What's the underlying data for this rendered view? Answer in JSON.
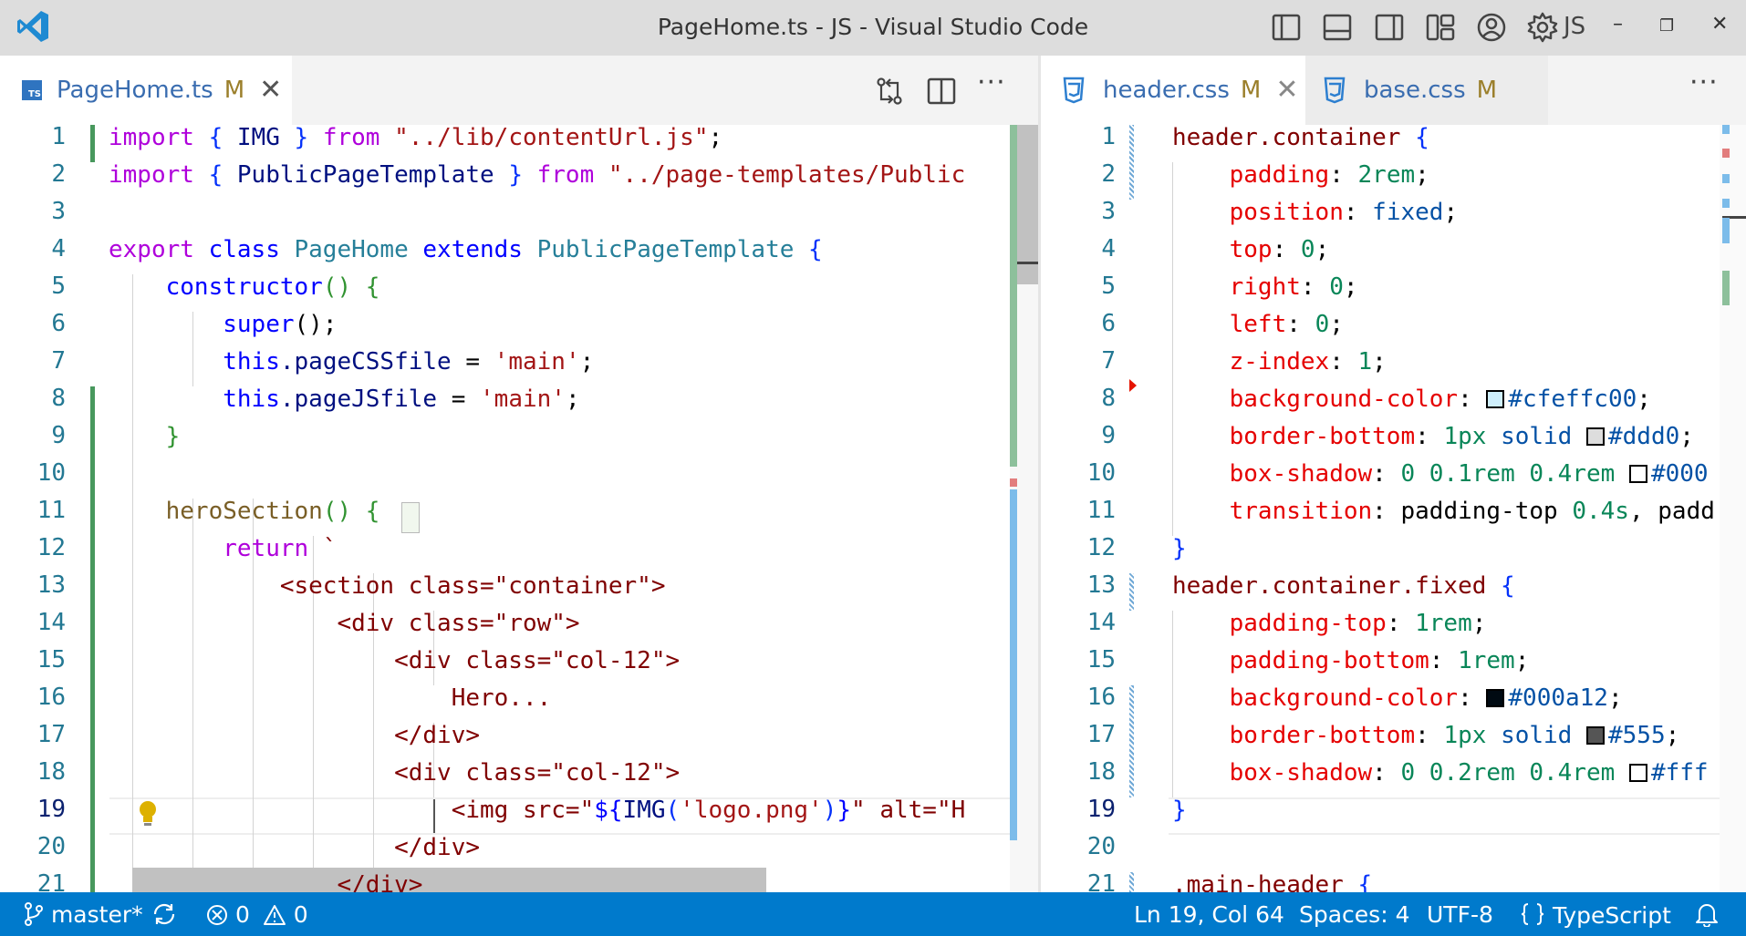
{
  "window": {
    "title": "PageHome.ts - JS - Visual Studio Code",
    "account_label": "JS",
    "controls": {
      "minimize": "–",
      "restore": "❐",
      "close": "✕"
    }
  },
  "colors": {
    "accent": "#007acc",
    "modified_gutter": "#48985d",
    "titlebar": "#dddddd"
  },
  "left_editor": {
    "tab": {
      "filename": "PageHome.ts",
      "status": "M",
      "close": "✕",
      "more": "···"
    },
    "lines": [
      {
        "n": "1",
        "tokens": [
          [
            "import ",
            "kw"
          ],
          [
            "{ ",
            "p1"
          ],
          [
            "IMG ",
            "id"
          ],
          [
            "} ",
            "p1"
          ],
          [
            "from ",
            "kw"
          ],
          [
            "\"../lib/contentUrl.js\"",
            "str"
          ],
          [
            ";",
            "txt"
          ]
        ]
      },
      {
        "n": "2",
        "tokens": [
          [
            "import ",
            "kw"
          ],
          [
            "{ ",
            "p1"
          ],
          [
            "PublicPageTemplate ",
            "id"
          ],
          [
            "} ",
            "p1"
          ],
          [
            "from ",
            "kw"
          ],
          [
            "\"../page-templates/Public",
            "str"
          ]
        ]
      },
      {
        "n": "3",
        "tokens": []
      },
      {
        "n": "4",
        "tokens": [
          [
            "export ",
            "kw"
          ],
          [
            "class ",
            "kwb"
          ],
          [
            "PageHome ",
            "cls"
          ],
          [
            "extends ",
            "kwb"
          ],
          [
            "PublicPageTemplate ",
            "cls"
          ],
          [
            "{",
            "p1"
          ]
        ]
      },
      {
        "n": "5",
        "tokens": [
          [
            "    ",
            "txt"
          ],
          [
            "constructor",
            "kwb"
          ],
          [
            "() {",
            "p2"
          ]
        ]
      },
      {
        "n": "6",
        "tokens": [
          [
            "        ",
            "txt"
          ],
          [
            "super",
            "kwb"
          ],
          [
            "();",
            "txt"
          ]
        ]
      },
      {
        "n": "7",
        "tokens": [
          [
            "        ",
            "txt"
          ],
          [
            "this",
            "kwb"
          ],
          [
            ".pageCSSfile ",
            "id"
          ],
          [
            "= ",
            "txt"
          ],
          [
            "'main'",
            "str"
          ],
          [
            ";",
            "txt"
          ]
        ]
      },
      {
        "n": "8",
        "tokens": [
          [
            "        ",
            "txt"
          ],
          [
            "this",
            "kwb"
          ],
          [
            ".pageJSfile ",
            "id"
          ],
          [
            "= ",
            "txt"
          ],
          [
            "'main'",
            "str"
          ],
          [
            ";",
            "txt"
          ]
        ]
      },
      {
        "n": "9",
        "tokens": [
          [
            "    ",
            "txt"
          ],
          [
            "}",
            "p2"
          ]
        ]
      },
      {
        "n": "10",
        "tokens": []
      },
      {
        "n": "11",
        "tokens": [
          [
            "    ",
            "txt"
          ],
          [
            "heroSection",
            "fn"
          ],
          [
            "() ",
            "p2"
          ],
          [
            "{",
            "p2"
          ]
        ]
      },
      {
        "n": "12",
        "tokens": [
          [
            "        ",
            "txt"
          ],
          [
            "return ",
            "kw"
          ],
          [
            "`",
            "tpl"
          ]
        ]
      },
      {
        "n": "13",
        "tokens": [
          [
            "            ",
            "txt"
          ],
          [
            "<section class=\"container\">",
            "tpl"
          ]
        ]
      },
      {
        "n": "14",
        "tokens": [
          [
            "                ",
            "txt"
          ],
          [
            "<div class=\"row\">",
            "tpl"
          ]
        ]
      },
      {
        "n": "15",
        "tokens": [
          [
            "                    ",
            "txt"
          ],
          [
            "<div class=\"col-12\">",
            "tpl"
          ]
        ]
      },
      {
        "n": "16",
        "tokens": [
          [
            "                        ",
            "txt"
          ],
          [
            "Hero...",
            "tpl"
          ]
        ]
      },
      {
        "n": "17",
        "tokens": [
          [
            "                    ",
            "txt"
          ],
          [
            "</div>",
            "tpl"
          ]
        ]
      },
      {
        "n": "18",
        "tokens": [
          [
            "                    ",
            "txt"
          ],
          [
            "<div class=\"col-12\">",
            "tpl"
          ]
        ]
      },
      {
        "n": "19",
        "tokens": [
          [
            "                        ",
            "txt"
          ],
          [
            "<img src=\"",
            "tpl"
          ],
          [
            "${",
            "kwb"
          ],
          [
            "IMG",
            "id"
          ],
          [
            "(",
            "p1"
          ],
          [
            "'logo.png'",
            "str"
          ],
          [
            ")",
            "p1"
          ],
          [
            "}",
            "kwb"
          ],
          [
            "\" alt=\"H",
            "tpl"
          ]
        ]
      },
      {
        "n": "20",
        "tokens": [
          [
            "                    ",
            "txt"
          ],
          [
            "</div>",
            "tpl"
          ]
        ]
      },
      {
        "n": "21",
        "tokens": [
          [
            "                ",
            "txt"
          ],
          [
            "</div>",
            "tpl"
          ]
        ]
      }
    ]
  },
  "right_editor": {
    "tabs": [
      {
        "filename": "header.css",
        "status": "M",
        "close": "✕"
      },
      {
        "filename": "base.css",
        "status": "M"
      }
    ],
    "more": "···",
    "lines": [
      {
        "n": "1",
        "tokens": [
          [
            "header.container ",
            "sel"
          ],
          [
            "{",
            "p1"
          ]
        ]
      },
      {
        "n": "2",
        "tokens": [
          [
            "    ",
            "txt"
          ],
          [
            "padding",
            "prop"
          ],
          [
            ": ",
            "txt"
          ],
          [
            "2rem",
            "num"
          ],
          [
            ";",
            "txt"
          ]
        ]
      },
      {
        "n": "3",
        "tokens": [
          [
            "    ",
            "txt"
          ],
          [
            "position",
            "prop"
          ],
          [
            ": ",
            "txt"
          ],
          [
            "fixed",
            "val"
          ],
          [
            ";",
            "txt"
          ]
        ]
      },
      {
        "n": "4",
        "tokens": [
          [
            "    ",
            "txt"
          ],
          [
            "top",
            "prop"
          ],
          [
            ": ",
            "txt"
          ],
          [
            "0",
            "num"
          ],
          [
            ";",
            "txt"
          ]
        ]
      },
      {
        "n": "5",
        "tokens": [
          [
            "    ",
            "txt"
          ],
          [
            "right",
            "prop"
          ],
          [
            ": ",
            "txt"
          ],
          [
            "0",
            "num"
          ],
          [
            ";",
            "txt"
          ]
        ]
      },
      {
        "n": "6",
        "tokens": [
          [
            "    ",
            "txt"
          ],
          [
            "left",
            "prop"
          ],
          [
            ": ",
            "txt"
          ],
          [
            "0",
            "num"
          ],
          [
            ";",
            "txt"
          ]
        ]
      },
      {
        "n": "7",
        "tokens": [
          [
            "    ",
            "txt"
          ],
          [
            "z-index",
            "prop"
          ],
          [
            ": ",
            "txt"
          ],
          [
            "1",
            "num"
          ],
          [
            ";",
            "txt"
          ]
        ]
      },
      {
        "n": "8",
        "tokens": [
          [
            "    ",
            "txt"
          ],
          [
            "background-color",
            "prop"
          ],
          [
            ": ",
            "txt"
          ],
          [
            "#cfeffc",
            "sw"
          ],
          [
            "#cfeffc00",
            "val"
          ],
          [
            ";",
            "txt"
          ]
        ]
      },
      {
        "n": "9",
        "tokens": [
          [
            "    ",
            "txt"
          ],
          [
            "border-bottom",
            "prop"
          ],
          [
            ": ",
            "txt"
          ],
          [
            "1px ",
            "num"
          ],
          [
            "solid ",
            "val"
          ],
          [
            "#dddddd",
            "sw"
          ],
          [
            "#ddd0",
            "val"
          ],
          [
            ";",
            "txt"
          ]
        ]
      },
      {
        "n": "10",
        "tokens": [
          [
            "    ",
            "txt"
          ],
          [
            "box-shadow",
            "prop"
          ],
          [
            ": ",
            "txt"
          ],
          [
            "0 ",
            "num"
          ],
          [
            "0.1rem ",
            "num"
          ],
          [
            "0.4rem ",
            "num"
          ],
          [
            "#ffffff",
            "sw"
          ],
          [
            "#000",
            "val"
          ]
        ]
      },
      {
        "n": "11",
        "tokens": [
          [
            "    ",
            "txt"
          ],
          [
            "transition",
            "prop"
          ],
          [
            ": ",
            "txt"
          ],
          [
            "padding-top ",
            "txt"
          ],
          [
            "0.4s",
            "num"
          ],
          [
            ", padd",
            "txt"
          ]
        ]
      },
      {
        "n": "12",
        "tokens": [
          [
            "}",
            "p1"
          ]
        ]
      },
      {
        "n": "13",
        "tokens": [
          [
            "header.container.fixed ",
            "sel"
          ],
          [
            "{",
            "p1"
          ]
        ]
      },
      {
        "n": "14",
        "tokens": [
          [
            "    ",
            "txt"
          ],
          [
            "padding-top",
            "prop"
          ],
          [
            ": ",
            "txt"
          ],
          [
            "1rem",
            "num"
          ],
          [
            ";",
            "txt"
          ]
        ]
      },
      {
        "n": "15",
        "tokens": [
          [
            "    ",
            "txt"
          ],
          [
            "padding-bottom",
            "prop"
          ],
          [
            ": ",
            "txt"
          ],
          [
            "1rem",
            "num"
          ],
          [
            ";",
            "txt"
          ]
        ]
      },
      {
        "n": "16",
        "tokens": [
          [
            "    ",
            "txt"
          ],
          [
            "background-color",
            "prop"
          ],
          [
            ": ",
            "txt"
          ],
          [
            "#000a12",
            "sw"
          ],
          [
            "#000a12",
            "val"
          ],
          [
            ";",
            "txt"
          ]
        ]
      },
      {
        "n": "17",
        "tokens": [
          [
            "    ",
            "txt"
          ],
          [
            "border-bottom",
            "prop"
          ],
          [
            ": ",
            "txt"
          ],
          [
            "1px ",
            "num"
          ],
          [
            "solid ",
            "val"
          ],
          [
            "#555555",
            "sw"
          ],
          [
            "#555",
            "val"
          ],
          [
            ";",
            "txt"
          ]
        ]
      },
      {
        "n": "18",
        "tokens": [
          [
            "    ",
            "txt"
          ],
          [
            "box-shadow",
            "prop"
          ],
          [
            ": ",
            "txt"
          ],
          [
            "0 ",
            "num"
          ],
          [
            "0.2rem ",
            "num"
          ],
          [
            "0.4rem ",
            "num"
          ],
          [
            "#ffffff",
            "sw"
          ],
          [
            "#fff",
            "val"
          ]
        ]
      },
      {
        "n": "19",
        "tokens": [
          [
            "}",
            "p1"
          ]
        ]
      },
      {
        "n": "20",
        "tokens": []
      },
      {
        "n": "21",
        "tokens": [
          [
            ".main-header ",
            "sel"
          ],
          [
            "{",
            "p1"
          ]
        ]
      }
    ]
  },
  "cursor": {
    "active_line": "19"
  },
  "statusbar": {
    "branch": "master*",
    "errors": "0",
    "warnings": "0",
    "position": "Ln 19, Col 64",
    "spaces": "Spaces: 4",
    "encoding": "UTF-8",
    "language": "TypeScript"
  }
}
